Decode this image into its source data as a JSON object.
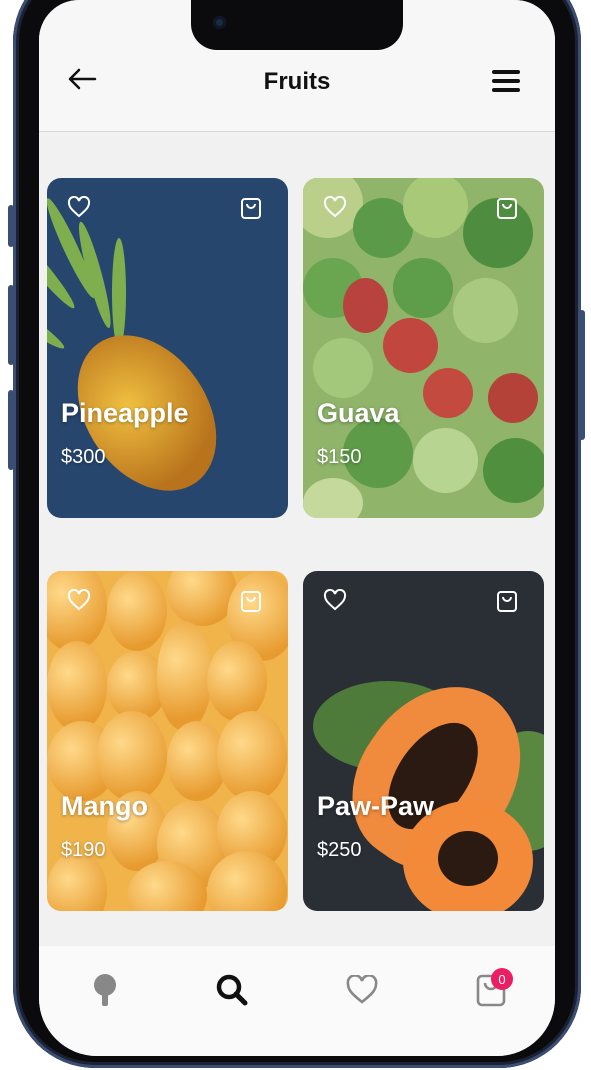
{
  "header": {
    "title": "Fruits"
  },
  "products": [
    {
      "name": "Pineapple",
      "price": "$300"
    },
    {
      "name": "Guava",
      "price": "$150"
    },
    {
      "name": "Mango",
      "price": "$190"
    },
    {
      "name": "Paw-Paw",
      "price": "$250"
    }
  ],
  "tabbar": {
    "items": [
      "tree-icon",
      "search-icon",
      "heart-icon",
      "shopping-bag-icon"
    ],
    "cart_badge": "0"
  },
  "colors": {
    "badge": "#e91e63",
    "active_tab": "#111111",
    "inactive_tab": "#888888"
  }
}
